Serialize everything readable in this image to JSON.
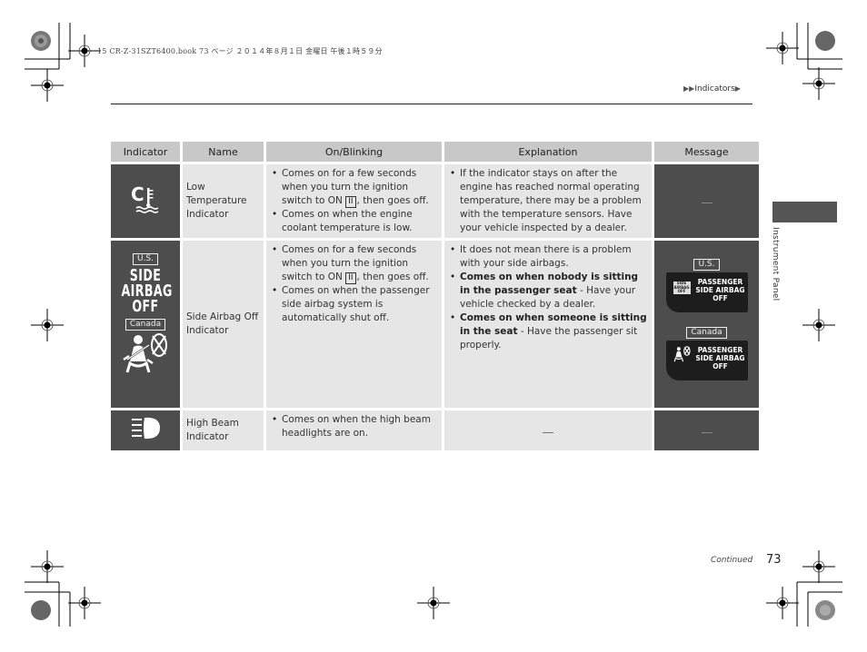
{
  "print_header": "15 CR-Z-31SZT6400.book  73 ページ  ２０１４年８月１日  金曜日  午後１時５９分",
  "breadcrumb": {
    "prefix_icon": "double-triangle-right-icon",
    "label": "Indicators",
    "suffix_icon": "triangle-right-icon"
  },
  "side_tab": {
    "label": "Instrument Panel"
  },
  "table": {
    "headers": [
      "Indicator",
      "Name",
      "On/Blinking",
      "Explanation",
      "Message"
    ],
    "rows": [
      {
        "icon": "low-coolant-temperature-icon",
        "name": "Low Temperature Indicator",
        "name_lines": [
          "Low",
          "Temperature",
          "Indicator"
        ],
        "on_blinking": [
          {
            "pre": "Comes on for a few seconds when you turn the ignition switch to ON ",
            "pos": "II",
            "post": ", then goes off."
          },
          {
            "pre": "Comes on when the engine coolant temperature is low.",
            "pos": "",
            "post": ""
          }
        ],
        "explanation": [
          {
            "bold": "",
            "text": "If the indicator stays on after the engine has reached normal operating temperature, there may be a problem with the temperature sensors. Have your vehicle inspected by a dealer."
          }
        ],
        "message": "—"
      },
      {
        "icon": "side-airbag-off-icon",
        "icon_regions": [
          "U.S.",
          "Canada"
        ],
        "icon_text_lines": [
          "SIDE",
          "AIRBAG",
          "OFF"
        ],
        "name": "Side Airbag Off Indicator",
        "name_lines": [
          "Side Airbag Off",
          "Indicator"
        ],
        "on_blinking": [
          {
            "pre": "Comes on for a few seconds when you turn the ignition switch to ON ",
            "pos": "II",
            "post": ", then goes off."
          },
          {
            "pre": "Comes on when the passenger side airbag system is automatically shut off.",
            "pos": "",
            "post": ""
          }
        ],
        "explanation": [
          {
            "bold": "",
            "text": "It does not mean there is a problem with your side airbags."
          },
          {
            "bold": "Comes on when nobody is sitting in the passenger seat",
            "text": " - Have your vehicle checked by a dealer."
          },
          {
            "bold": "Comes on when someone is sitting in the seat",
            "text": " - Have the passenger sit properly."
          }
        ],
        "message_panels": [
          {
            "region": "U.S.",
            "mini_icon_text": "SIDE AIRBAG OFF",
            "lines": [
              "PASSENGER",
              "SIDE AIRBAG",
              "OFF"
            ]
          },
          {
            "region": "Canada",
            "mini_icon": "seatbelt-person-x-icon",
            "lines": [
              "PASSENGER",
              "SIDE AIRBAG",
              "OFF"
            ]
          }
        ]
      },
      {
        "icon": "high-beam-icon",
        "name": "High Beam Indicator",
        "name_lines": [
          "High Beam",
          "Indicator"
        ],
        "on_blinking": [
          {
            "pre": "Comes on when the high beam headlights are on.",
            "pos": "",
            "post": ""
          }
        ],
        "explanation_text": "—",
        "message": "—"
      }
    ]
  },
  "footer": {
    "continued": "Continued",
    "page_number": "73"
  }
}
